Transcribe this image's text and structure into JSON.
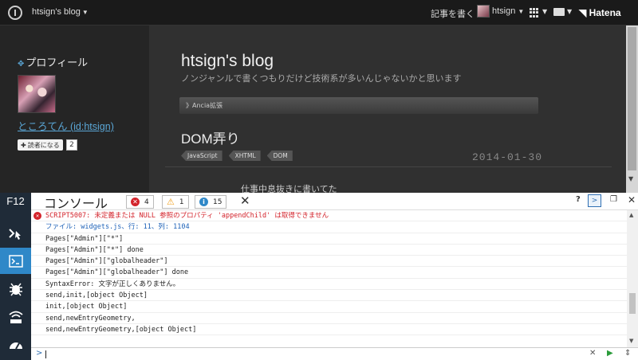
{
  "topbar": {
    "blog_switch": "htsign's blog",
    "write_link": "記事を書く",
    "user_name": "htsign",
    "hatena_logo": "Hatena"
  },
  "sidebar": {
    "profile_heading": "プロフィール",
    "profile_name": "ところてん (id:htsign)",
    "subscribe_label": "読者になる",
    "subscriber_count": "2"
  },
  "main": {
    "blog_title": "htsign's blog",
    "blog_description": "ノンジャンルで書くつもりだけど技術系が多いんじゃないかと思います",
    "breadcrumb": "》Ancia拡張",
    "entry_title": "DOM弄り",
    "tags": [
      "JavaScript",
      "XHTML",
      "DOM"
    ],
    "entry_date": "2014-01-30",
    "entry_body": "仕事中息抜きに書いてた"
  },
  "devtools": {
    "f12_label": "F12",
    "console_title": "コンソール",
    "error_count": "4",
    "warning_count": "1",
    "info_count": "15",
    "help_label": "?",
    "log": [
      {
        "type": "error",
        "text": "SCRIPT5007: 未定義または NULL 参照のプロパティ 'appendChild' は取得できません"
      },
      {
        "type": "link",
        "text": "ファイル: widgets.js、行: 11、列: 1104"
      },
      {
        "type": "log",
        "text": "Pages[\"Admin\"][\"*\"]"
      },
      {
        "type": "log",
        "text": "Pages[\"Admin\"][\"*\"] done"
      },
      {
        "type": "log",
        "text": "Pages[\"Admin\"][\"globalheader\"]"
      },
      {
        "type": "log",
        "text": "Pages[\"Admin\"][\"globalheader\"] done"
      },
      {
        "type": "log",
        "text": "SyntaxError: 文字が正しくありません。"
      },
      {
        "type": "log",
        "text": "send,init,[object Object]"
      },
      {
        "type": "log",
        "text": "init,[object Object]"
      },
      {
        "type": "log",
        "text": "send,newEntryGeometry,"
      },
      {
        "type": "log",
        "text": "send,newEntryGeometry,[object Object]"
      }
    ],
    "colors": {
      "error": "#d3232b",
      "warning": "#f0a020",
      "info": "#2f88c8",
      "sidebar": "#1f2b38"
    }
  }
}
